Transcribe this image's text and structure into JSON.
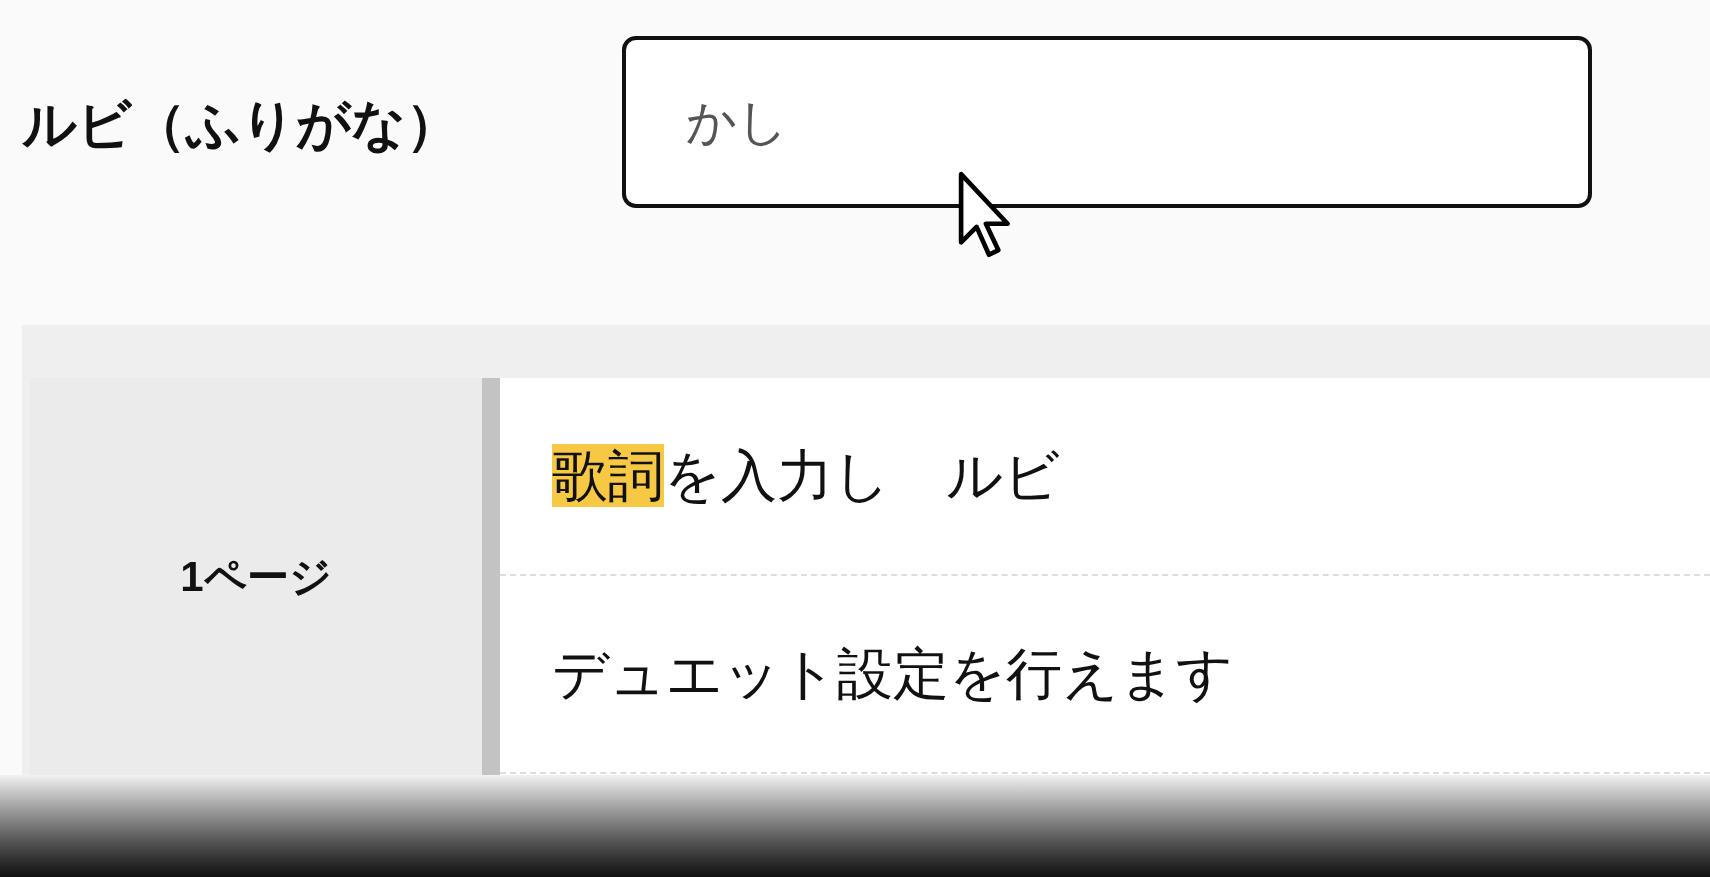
{
  "ruby_field": {
    "label": "ルビ（ふりがな）",
    "value": "かし"
  },
  "page": {
    "label": "1ページ",
    "lines": [
      {
        "segments": [
          {
            "text": "歌詞",
            "highlighted": true
          },
          {
            "text": "を入力し　ルビ",
            "highlighted": false
          }
        ]
      },
      {
        "segments": [
          {
            "text": "デュエット設定を行えます",
            "highlighted": false
          }
        ]
      }
    ]
  }
}
